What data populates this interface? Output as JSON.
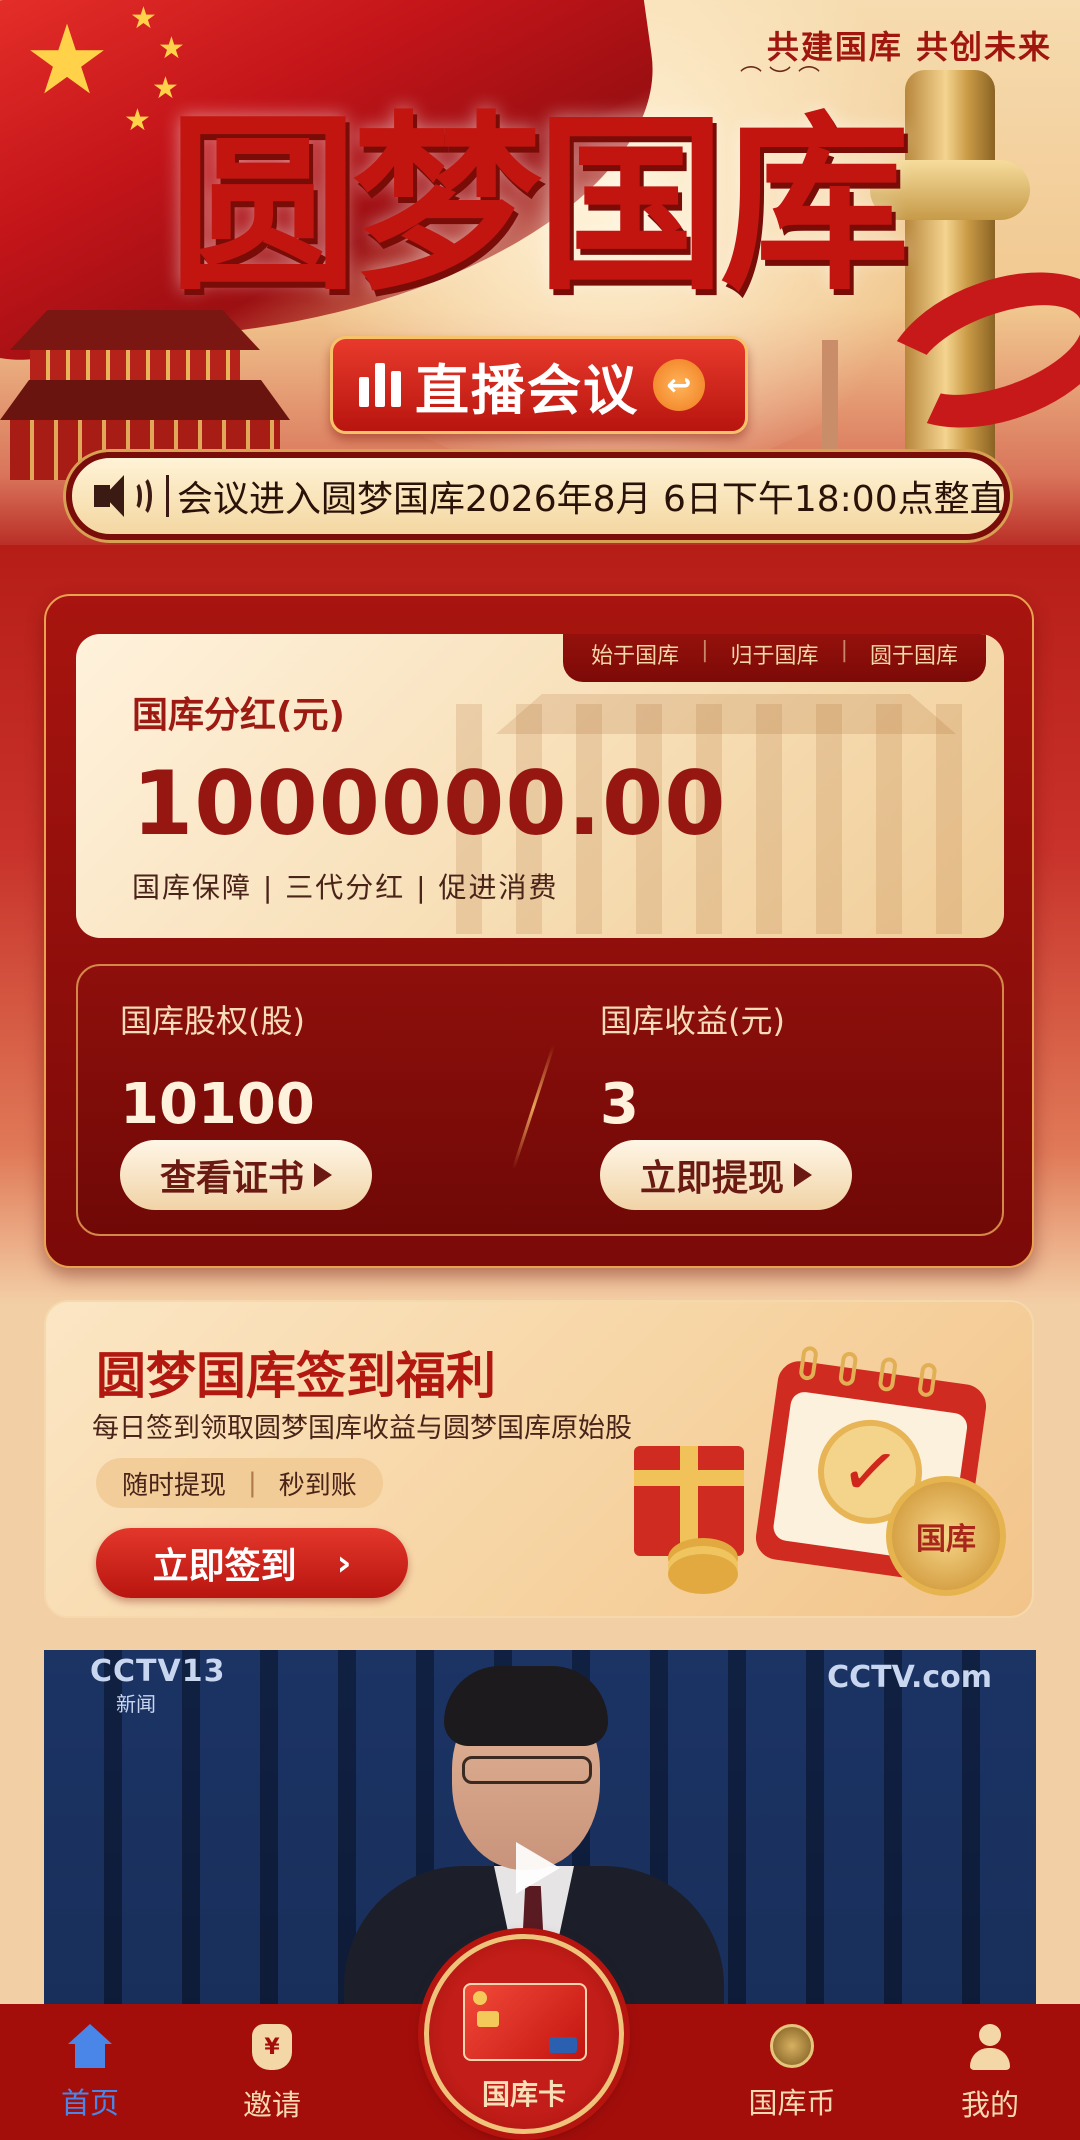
{
  "hero": {
    "slogan": "共建国库  共创未来",
    "title": "圆梦国库",
    "live_button_label": "直播会议"
  },
  "marquee": {
    "text": "会议进入圆梦国库2026年8月 6日下午18:00点整直"
  },
  "bonus": {
    "tags": [
      "始于国库",
      "归于国库",
      "圆于国库"
    ],
    "label": "国库分红(元)",
    "amount": "1000000.00",
    "subtitle": "国库保障 | 三代分红 | 促进消费"
  },
  "stats": {
    "equity_label": "国库股权(股)",
    "equity_value": "10100",
    "equity_button": "查看证书",
    "income_label": "国库收益(元)",
    "income_value": "3",
    "income_button": "立即提现"
  },
  "signin": {
    "title": "圆梦国库签到福利",
    "description": "每日签到领取圆梦国库收益与圆梦国库原始股",
    "pill_left": "随时提现",
    "pill_right": "秒到账",
    "button_label": "立即签到",
    "coin_text": "国库"
  },
  "video": {
    "logo_left": "CCTV13",
    "logo_left_sub": "新闻",
    "logo_right": "CCTV.com"
  },
  "nav": {
    "home": "首页",
    "invite": "邀请",
    "card": "国库卡",
    "coin": "国库币",
    "mine": "我的",
    "active_color": "#4a86e8"
  },
  "colors": {
    "primary_red": "#b8150f",
    "gold": "#e9a24f",
    "cream": "#fff2dc"
  }
}
